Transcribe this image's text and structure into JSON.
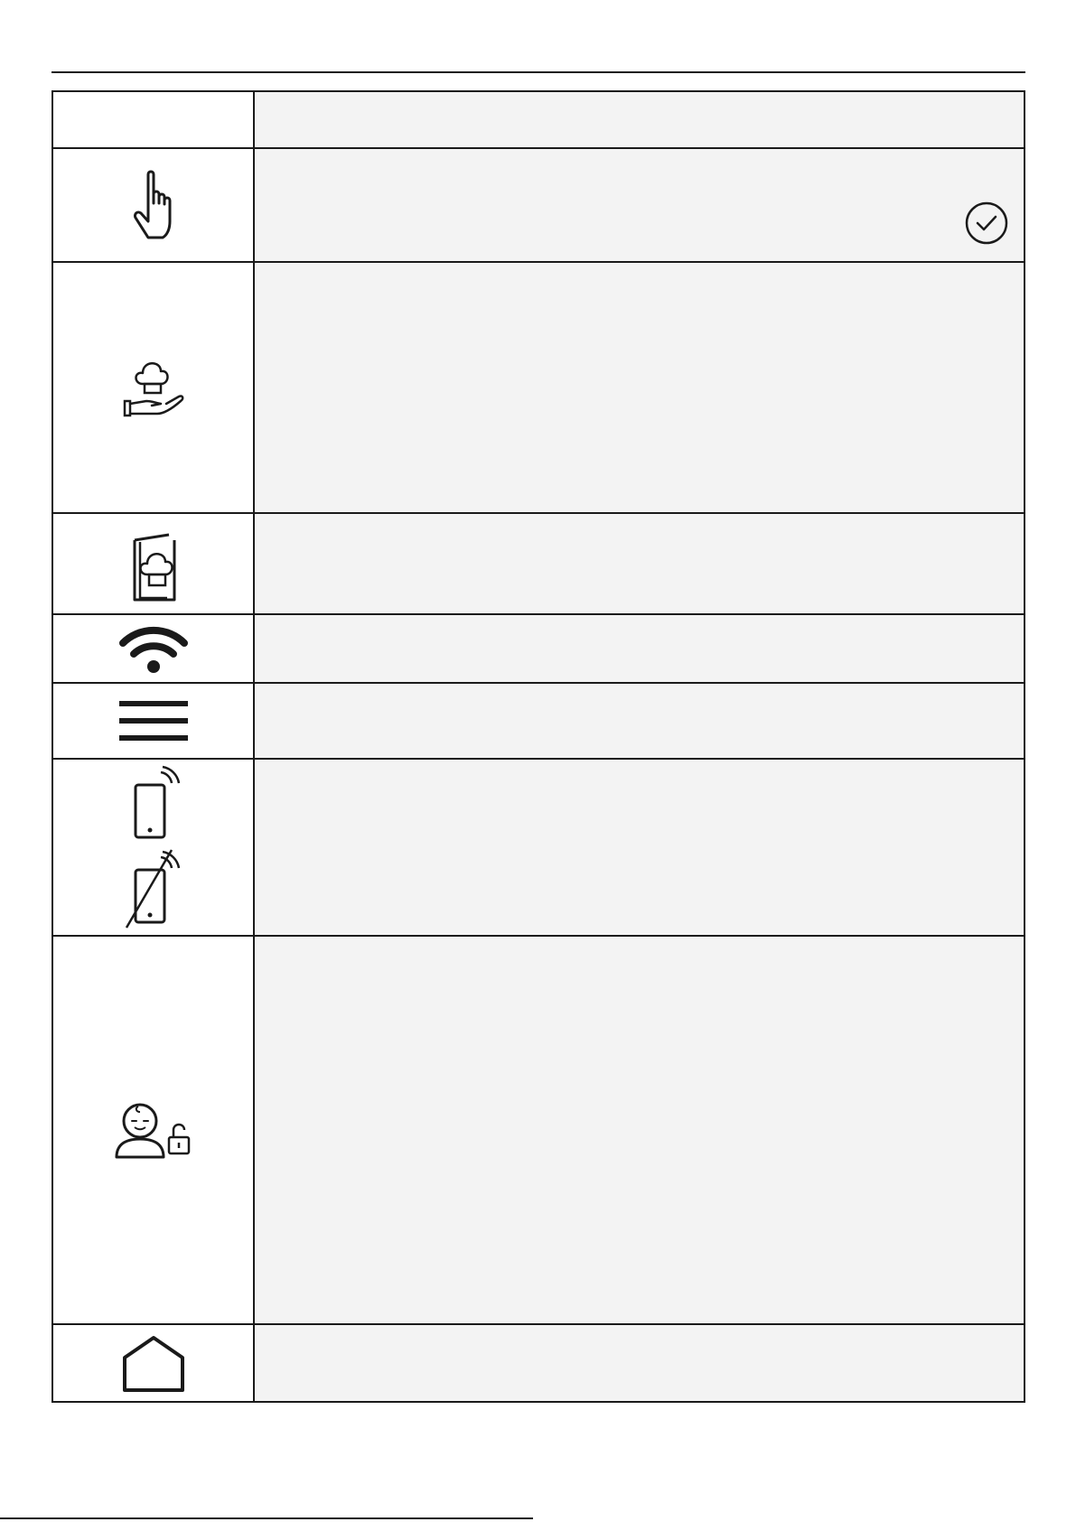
{
  "rows": [
    {
      "icon": "blank",
      "description": ""
    },
    {
      "icon": "touch-hand-icon",
      "description": "",
      "extra_icon": "check-circle-icon"
    },
    {
      "icon": "chef-hat-hand-icon",
      "description": ""
    },
    {
      "icon": "chef-hat-book-icon",
      "description": ""
    },
    {
      "icon": "wifi-icon",
      "description": ""
    },
    {
      "icon": "menu-icon",
      "description": ""
    },
    {
      "icon": "phone-remote-icon",
      "description": ""
    },
    {
      "icon": "child-lock-icon",
      "description": ""
    },
    {
      "icon": "home-icon",
      "description": ""
    }
  ],
  "colors": {
    "line": "#1a1a1a",
    "cell_fill": "#f3f3f3"
  }
}
